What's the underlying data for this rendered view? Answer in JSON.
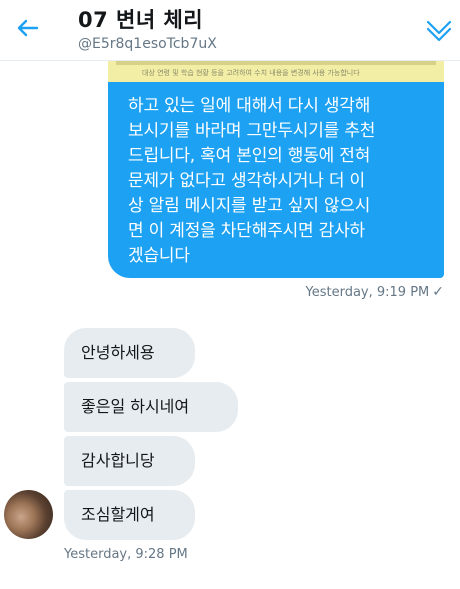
{
  "header": {
    "title": "07 변녀 체리",
    "handle": "@E5r8q1esoTcb7uX",
    "back_icon": "arrow-left-icon",
    "options_icon": "chevron-down-icon",
    "accent_color": "#1da1f2"
  },
  "outgoing": {
    "image_caption": "대상 연령 및 학습 현황 등을 고려하여 수치 내용을 변경해 사용 가능합니다",
    "message": "하고 있는 일에 대해서 다시 생각해\n보시기를 바라며 그만두시기를 추천\n드립니다, 혹여 본인의 행동에 전혀\n문제가 없다고 생각하시거나 더 이\n상 알림 메시지를 받고 싶지 않으시\n면 이 계정을 차단해주시면 감사하\n겠습니다",
    "timestamp": "Yesterday, 9:19 PM",
    "status_icon": "checkmark-icon",
    "status_glyph": "✓",
    "bubble_color": "#1da1f2"
  },
  "incoming": {
    "messages": [
      "안녕하세용",
      "좋은일 하시네여",
      "감사합니당",
      "조심할게여"
    ],
    "timestamp": "Yesterday, 9:28 PM",
    "bubble_color": "#e6ecf0"
  }
}
